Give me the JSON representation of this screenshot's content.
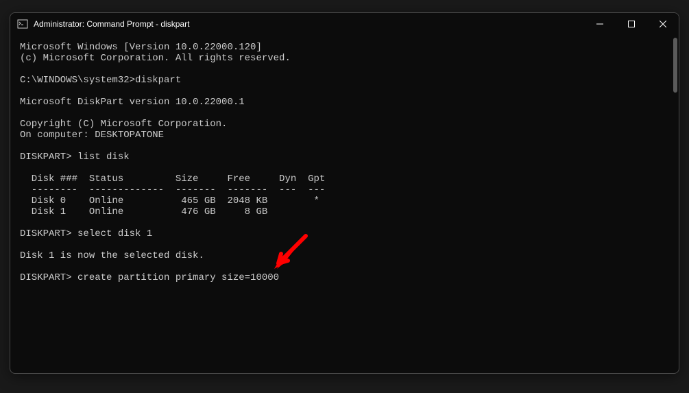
{
  "window": {
    "title": "Administrator: Command Prompt - diskpart"
  },
  "terminal": {
    "lines": [
      "Microsoft Windows [Version 10.0.22000.120]",
      "(c) Microsoft Corporation. All rights reserved.",
      "",
      "C:\\WINDOWS\\system32>diskpart",
      "",
      "Microsoft DiskPart version 10.0.22000.1",
      "",
      "Copyright (C) Microsoft Corporation.",
      "On computer: DESKTOPATONE",
      "",
      "DISKPART> list disk",
      "",
      "  Disk ###  Status         Size     Free     Dyn  Gpt",
      "  --------  -------------  -------  -------  ---  ---",
      "  Disk 0    Online          465 GB  2048 KB        *",
      "  Disk 1    Online          476 GB     8 GB",
      "",
      "DISKPART> select disk 1",
      "",
      "Disk 1 is now the selected disk.",
      "",
      "DISKPART> create partition primary size=10000"
    ]
  },
  "disks": [
    {
      "id": "Disk 0",
      "status": "Online",
      "size": "465 GB",
      "free": "2048 KB",
      "dyn": "",
      "gpt": "*"
    },
    {
      "id": "Disk 1",
      "status": "Online",
      "size": "476 GB",
      "free": "8 GB",
      "dyn": "",
      "gpt": ""
    }
  ],
  "commands": {
    "first_prompt": "C:\\WINDOWS\\system32>",
    "first_cmd": "diskpart",
    "dp_prompt": "DISKPART>",
    "cmd_list": "list disk",
    "cmd_select": "select disk 1",
    "cmd_create": "create partition primary size=10000"
  },
  "annotation": {
    "arrow_color": "#ff0000"
  }
}
